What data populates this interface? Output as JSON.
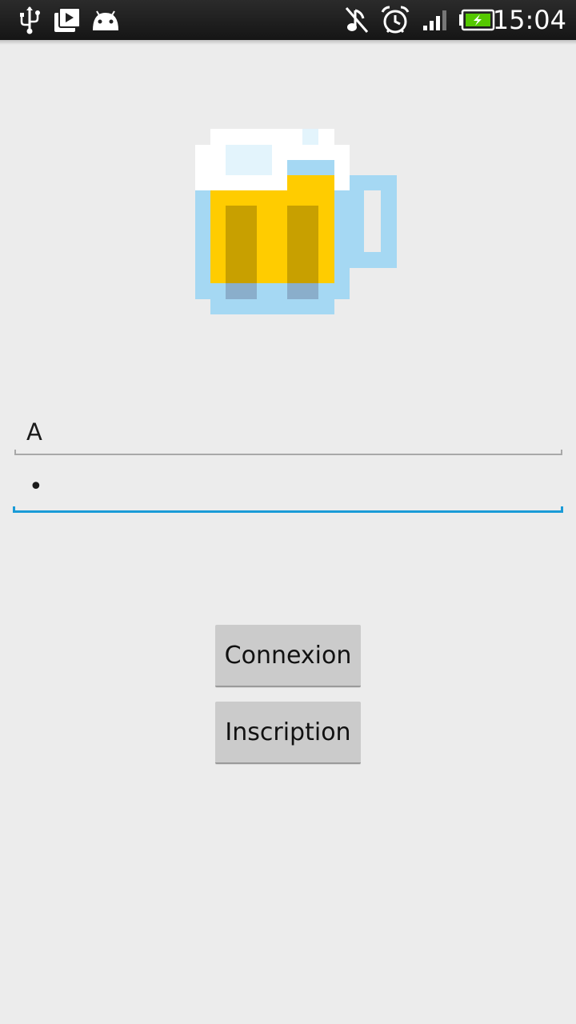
{
  "status_bar": {
    "time": "15:04",
    "icons": [
      "usb-icon",
      "play-store-icon",
      "android-icon",
      "music-muted-icon",
      "alarm-icon",
      "signal-icon",
      "battery-charging-icon"
    ]
  },
  "login": {
    "username_value": "A",
    "password_value": "•"
  },
  "buttons": {
    "login_label": "Connexion",
    "signup_label": "Inscription"
  },
  "colors": {
    "beer": "#ffcc00",
    "glass": "#a5d8f3",
    "foam": "#ffffff",
    "accent": "#1a9bd7",
    "background": "#ececec"
  }
}
